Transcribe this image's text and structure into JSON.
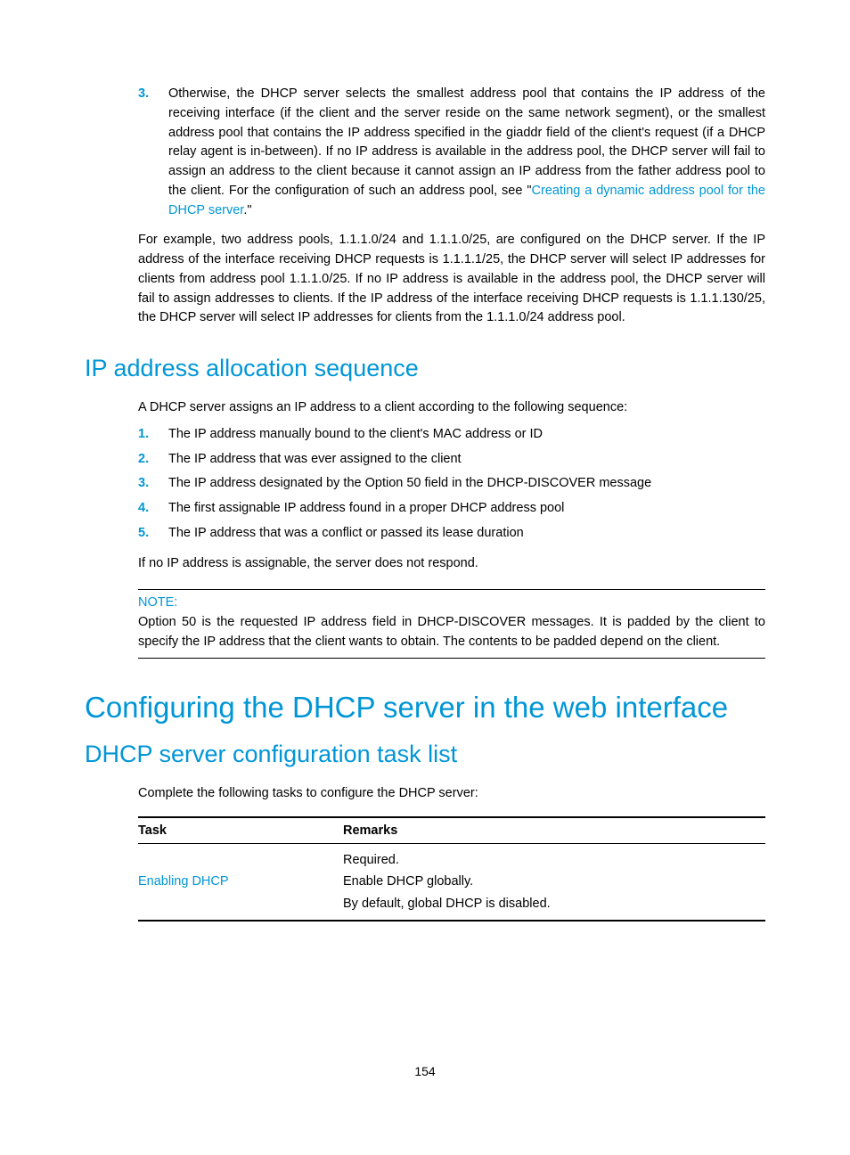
{
  "item3": {
    "num": "3.",
    "text_a": "Otherwise, the DHCP server selects the smallest address pool that contains the IP address of the receiving interface (if the client and the server reside on the same network segment), or the smallest address pool that contains the IP address specified in the giaddr field of the client's request (if a DHCP relay agent is in-between). If no IP address is available in the address pool, the DHCP server will fail to assign an address to the client because it cannot assign an IP address from the father address pool to the client.  For the configuration of such an address pool, see \"",
    "link": "Creating a dynamic address pool for the DHCP server",
    "text_b": ".\""
  },
  "example_para": "For example, two address pools, 1.1.1.0/24 and 1.1.1.0/25, are configured on the DHCP server. If the IP address of the interface receiving DHCP requests is 1.1.1.1/25, the DHCP server will select IP addresses for clients from address pool 1.1.1.0/25. If no IP address is available in the address pool, the DHCP server will fail to assign addresses to clients. If the IP address of the interface receiving DHCP requests is 1.1.1.130/25, the DHCP server will select IP addresses for clients from the 1.1.1.0/24 address pool.",
  "h2_allocation": "IP address allocation sequence",
  "alloc_intro": "A DHCP server assigns an IP address to a client according to the following sequence:",
  "alloc_list": [
    {
      "num": "1.",
      "text": "The IP address manually bound to the client's MAC address or ID"
    },
    {
      "num": "2.",
      "text": "The IP address that was ever assigned to the client"
    },
    {
      "num": "3.",
      "text": "The IP address designated by the Option 50 field in the DHCP-DISCOVER message"
    },
    {
      "num": "4.",
      "text": "The first assignable IP address found in a proper DHCP address pool"
    },
    {
      "num": "5.",
      "text": "The IP address that was a conflict or passed its lease duration"
    }
  ],
  "alloc_outro": "If no IP address is assignable, the server does not respond.",
  "note_label": "NOTE:",
  "note_text": "Option 50 is the requested IP address field in DHCP-DISCOVER messages. It is padded by the client to specify the IP address that the client wants to obtain. The contents to be padded depend on the client.",
  "h1_config": "Configuring the DHCP server in the web interface",
  "h2_tasklist": "DHCP server configuration task list",
  "task_intro": "Complete the following tasks to configure the DHCP server:",
  "table": {
    "headers": {
      "task": "Task",
      "remarks": "Remarks"
    },
    "row1": {
      "task_link": "Enabling DHCP",
      "remarks_line1": "Required.",
      "remarks_line2": "Enable DHCP globally.",
      "remarks_line3": "By default, global DHCP is disabled."
    }
  },
  "page_number": "154"
}
